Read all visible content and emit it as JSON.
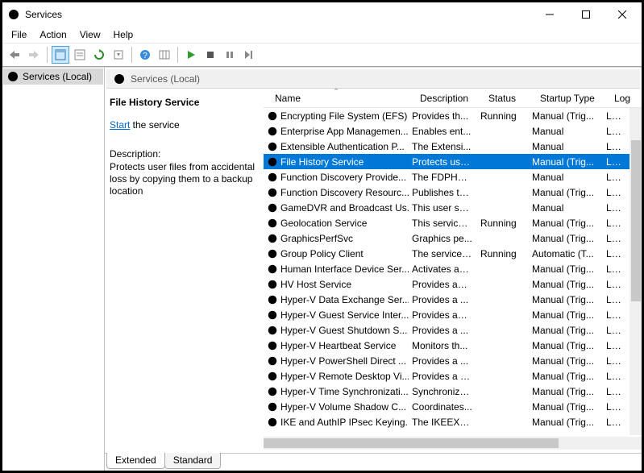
{
  "window": {
    "title": "Services"
  },
  "menu": {
    "file": "File",
    "action": "Action",
    "view": "View",
    "help": "Help"
  },
  "tree": {
    "root": "Services (Local)"
  },
  "pane_header": "Services (Local)",
  "detail": {
    "title": "File History Service",
    "start_link": "Start",
    "start_tail": " the service",
    "desc_label": "Description:",
    "description": "Protects user files from accidental loss by copying them to a backup location"
  },
  "columns": {
    "name": "Name",
    "desc": "Description",
    "status": "Status",
    "startup": "Startup Type",
    "logon": "Log"
  },
  "rows": [
    {
      "name": "Encrypting File System (EFS)",
      "desc": "Provides th...",
      "status": "Running",
      "startup": "Manual (Trig...",
      "logon": "Loca"
    },
    {
      "name": "Enterprise App Managemen...",
      "desc": "Enables ent...",
      "status": "",
      "startup": "Manual",
      "logon": "Loca"
    },
    {
      "name": "Extensible Authentication P...",
      "desc": "The Extensi...",
      "status": "",
      "startup": "Manual",
      "logon": "Loca"
    },
    {
      "name": "File History Service",
      "desc": "Protects use...",
      "status": "",
      "startup": "Manual (Trig...",
      "logon": "Loca",
      "selected": true
    },
    {
      "name": "Function Discovery Provide...",
      "desc": "The FDPHO...",
      "status": "",
      "startup": "Manual",
      "logon": "Loca"
    },
    {
      "name": "Function Discovery Resourc...",
      "desc": "Publishes th...",
      "status": "",
      "startup": "Manual (Trig...",
      "logon": "Loca"
    },
    {
      "name": "GameDVR and Broadcast Us...",
      "desc": "This user ser...",
      "status": "",
      "startup": "Manual",
      "logon": "Loca"
    },
    {
      "name": "Geolocation Service",
      "desc": "This service ...",
      "status": "Running",
      "startup": "Manual (Trig...",
      "logon": "Loca"
    },
    {
      "name": "GraphicsPerfSvc",
      "desc": "Graphics pe...",
      "status": "",
      "startup": "Manual (Trig...",
      "logon": "Loca"
    },
    {
      "name": "Group Policy Client",
      "desc": "The service i...",
      "status": "Running",
      "startup": "Automatic (T...",
      "logon": "Loca"
    },
    {
      "name": "Human Interface Device Ser...",
      "desc": "Activates an...",
      "status": "",
      "startup": "Manual (Trig...",
      "logon": "Loca"
    },
    {
      "name": "HV Host Service",
      "desc": "Provides an ...",
      "status": "",
      "startup": "Manual (Trig...",
      "logon": "Loca"
    },
    {
      "name": "Hyper-V Data Exchange Ser...",
      "desc": "Provides a ...",
      "status": "",
      "startup": "Manual (Trig...",
      "logon": "Loca"
    },
    {
      "name": "Hyper-V Guest Service Inter...",
      "desc": "Provides an ...",
      "status": "",
      "startup": "Manual (Trig...",
      "logon": "Loca"
    },
    {
      "name": "Hyper-V Guest Shutdown S...",
      "desc": "Provides a ...",
      "status": "",
      "startup": "Manual (Trig...",
      "logon": "Loca"
    },
    {
      "name": "Hyper-V Heartbeat Service",
      "desc": "Monitors th...",
      "status": "",
      "startup": "Manual (Trig...",
      "logon": "Loca"
    },
    {
      "name": "Hyper-V PowerShell Direct ...",
      "desc": "Provides a ...",
      "status": "",
      "startup": "Manual (Trig...",
      "logon": "Loca"
    },
    {
      "name": "Hyper-V Remote Desktop Vi...",
      "desc": "Provides a p...",
      "status": "",
      "startup": "Manual (Trig...",
      "logon": "Loca"
    },
    {
      "name": "Hyper-V Time Synchronizati...",
      "desc": "Synchronize...",
      "status": "",
      "startup": "Manual (Trig...",
      "logon": "Loca"
    },
    {
      "name": "Hyper-V Volume Shadow C...",
      "desc": "Coordinates...",
      "status": "",
      "startup": "Manual (Trig...",
      "logon": "Loca"
    },
    {
      "name": "IKE and AuthIP IPsec Keying...",
      "desc": "The IKEEXT ...",
      "status": "",
      "startup": "Manual (Trig...",
      "logon": "Loca"
    }
  ],
  "tabs": {
    "extended": "Extended",
    "standard": "Standard"
  }
}
